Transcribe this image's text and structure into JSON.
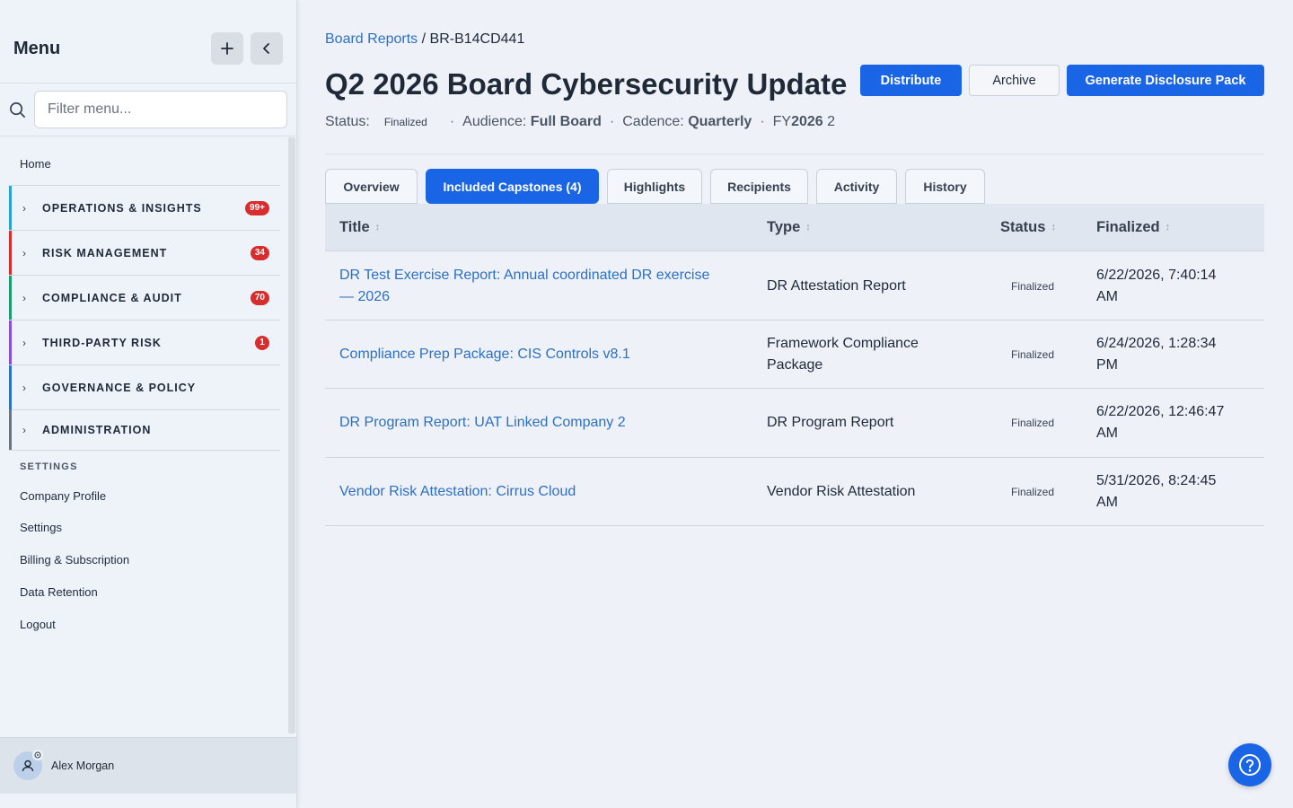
{
  "sidebar": {
    "title": "Menu",
    "filter_placeholder": "Filter menu...",
    "home_label": "Home",
    "groups": [
      {
        "label": "OPERATIONS & INSIGHTS",
        "badge": "99+",
        "color": "#29a3d6"
      },
      {
        "label": "RISK MANAGEMENT",
        "badge": "34",
        "color": "#d92d2d"
      },
      {
        "label": "COMPLIANCE & AUDIT",
        "badge": "70",
        "color": "#1c9b6e"
      },
      {
        "label": "THIRD-PARTY RISK",
        "badge": "1",
        "color": "#8a4fd8"
      },
      {
        "label": "GOVERNANCE & POLICY",
        "badge": "",
        "color": "#2d6fc2"
      },
      {
        "label": "ADMINISTRATION",
        "badge": "",
        "color": "#6b7280"
      }
    ],
    "settings_header": "SETTINGS",
    "settings_items": [
      "Company Profile",
      "Settings",
      "Billing & Subscription",
      "Data Retention",
      "Logout"
    ],
    "user_name": "Alex Morgan"
  },
  "breadcrumb": {
    "parent": "Board Reports",
    "separator": " / ",
    "current": "BR-B14CD441"
  },
  "page": {
    "title": "Q2 2026 Board Cybersecurity Update",
    "status_label": "Status:",
    "status_value": "Finalized",
    "audience_label": "Audience:",
    "audience_value": "Full Board",
    "cadence_label": "Cadence:",
    "cadence_value": "Quarterly",
    "fy_prefix": "FY",
    "fy_year": "2026",
    "fy_suffix": " 2"
  },
  "actions": {
    "distribute": "Distribute",
    "archive": "Archive",
    "generate": "Generate Disclosure Pack"
  },
  "tabs": [
    "Overview",
    "Included Capstones (4)",
    "Highlights",
    "Recipients",
    "Activity",
    "History"
  ],
  "active_tab": 1,
  "table": {
    "headers": {
      "title": "Title",
      "type": "Type",
      "status": "Status",
      "finalized": "Finalized"
    },
    "rows": [
      {
        "title_l1": "DR Test Exercise Report: Annual coordinated DR exercise",
        "title_l2": "— 2026",
        "type_l1": "DR Attestation Report",
        "type_l2": "",
        "status": "Finalized",
        "fin_l1": "6/22/2026, 7:40:14",
        "fin_l2": "AM"
      },
      {
        "title_l1": "Compliance Prep Package: CIS Controls v8.1",
        "title_l2": "",
        "type_l1": "Framework Compliance",
        "type_l2": "Package",
        "status": "Finalized",
        "fin_l1": "6/24/2026, 1:28:34",
        "fin_l2": "PM"
      },
      {
        "title_l1": "DR Program Report: UAT Linked Company 2",
        "title_l2": "",
        "type_l1": "DR Program Report",
        "type_l2": "",
        "status": "Finalized",
        "fin_l1": "6/22/2026, 12:46:47",
        "fin_l2": "AM"
      },
      {
        "title_l1": "Vendor Risk Attestation: Cirrus Cloud",
        "title_l2": "",
        "type_l1": "Vendor Risk Attestation",
        "type_l2": "",
        "status": "Finalized",
        "fin_l1": "5/31/2026, 8:24:45",
        "fin_l2": "AM"
      }
    ]
  },
  "colors": {
    "accent": "#1a65e6",
    "link": "#2d6fc2",
    "badge": "#d92d2d"
  }
}
